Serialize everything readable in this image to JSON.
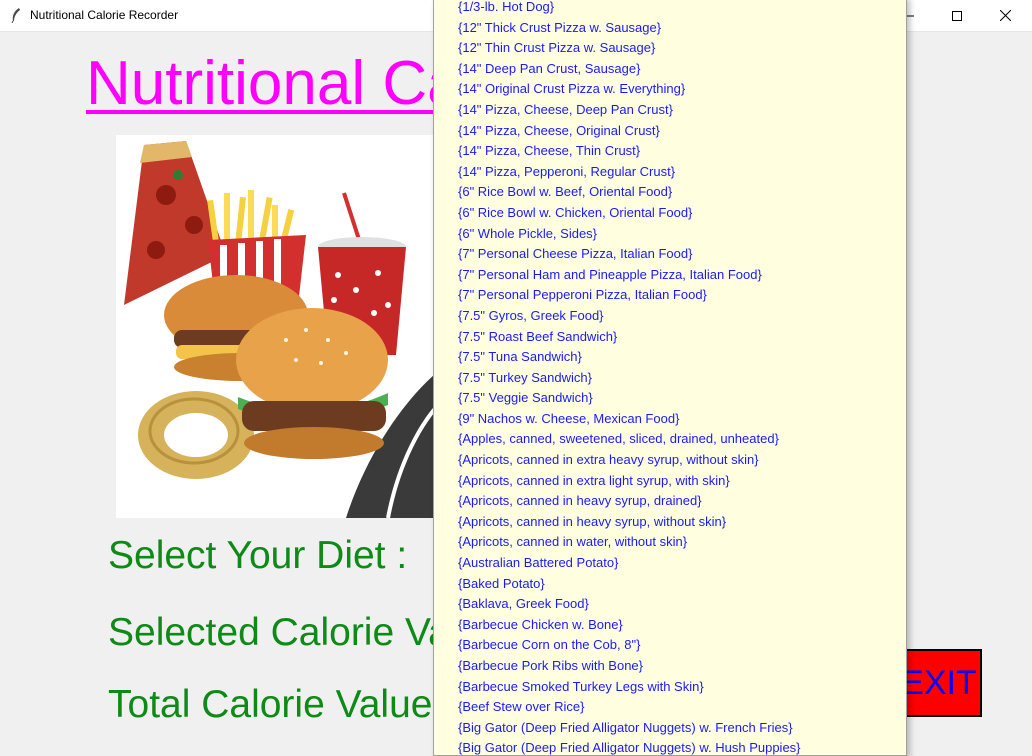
{
  "window": {
    "title": "Nutritional Calorie Recorder"
  },
  "heading": {
    "text": "Nutritional Calorie Recorder"
  },
  "labels": {
    "select_diet": "Select Your Diet :",
    "selected_calorie": "Selected Calorie Value",
    "total_calorie": "Total Calorie Value"
  },
  "exit_label": "EXIT",
  "icons": {
    "app": "feather-icon",
    "minimize": "minimize-icon",
    "maximize": "maximize-icon",
    "close": "close-icon"
  },
  "colors": {
    "heading": "#ff00ff",
    "labels": "#0e8a16",
    "exit_bg": "#ff0000",
    "exit_text": "#0000ff",
    "dropdown_bg": "#ffffe0",
    "dropdown_text": "#1a1aff"
  },
  "diet_options": [
    "{1/3-lb. Hot Dog}",
    "{12\" Thick Crust Pizza w. Sausage}",
    "{12\" Thin Crust Pizza w. Sausage}",
    "{14\" Deep Pan Crust, Sausage}",
    "{14\" Original Crust Pizza w. Everything}",
    "{14\" Pizza, Cheese, Deep Pan Crust}",
    "{14\" Pizza, Cheese, Original Crust}",
    "{14\" Pizza, Cheese, Thin Crust}",
    "{14\" Pizza, Pepperoni, Regular Crust}",
    "{6\" Rice Bowl w. Beef, Oriental Food}",
    "{6\" Rice Bowl w. Chicken, Oriental Food}",
    "{6\" Whole Pickle, Sides}",
    "{7\" Personal Cheese Pizza, Italian Food}",
    "{7\" Personal Ham and Pineapple Pizza, Italian Food}",
    "{7\" Personal Pepperoni Pizza, Italian Food}",
    "{7.5\" Gyros, Greek Food}",
    "{7.5\" Roast Beef Sandwich}",
    "{7.5\" Tuna Sandwich}",
    "{7.5\" Turkey Sandwich}",
    "{7.5\" Veggie Sandwich}",
    "{9\" Nachos w. Cheese, Mexican Food}",
    "{Apples, canned, sweetened, sliced, drained, unheated}",
    "{Apricots, canned in extra heavy syrup, without skin}",
    "{Apricots, canned in extra light syrup, with skin}",
    "{Apricots, canned in heavy syrup, drained}",
    "{Apricots, canned in heavy syrup, without skin}",
    "{Apricots, canned in water, without skin}",
    "{Australian Battered Potato}",
    "{Baked Potato}",
    "{Baklava, Greek Food}",
    "{Barbecue Chicken w. Bone}",
    "{Barbecue Corn on the Cob, 8\"}",
    "{Barbecue Pork Ribs with Bone}",
    "{Barbecue Smoked Turkey Legs with Skin}",
    "{Beef Stew over Rice}",
    "{Big Gator (Deep Fried Alligator Nuggets) w. French Fries}",
    "{Big Gator (Deep Fried Alligator Nuggets) w. Hush Puppies}"
  ]
}
